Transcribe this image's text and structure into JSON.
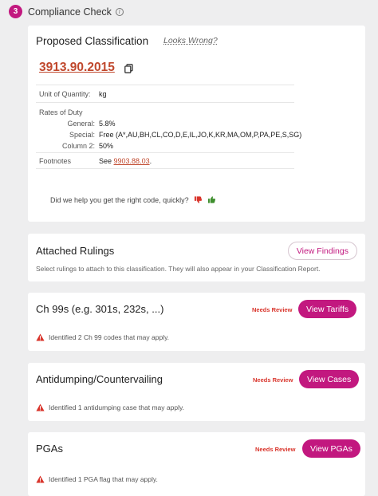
{
  "header": {
    "step_number": "3",
    "title": "Compliance Check",
    "info_icon": "info-icon"
  },
  "classification": {
    "title": "Proposed Classification",
    "looks_wrong_label": "Looks Wrong?",
    "hts_code": "3913.90.2015",
    "copy_icon": "copy-icon",
    "unit_of_quantity_label": "Unit of Quantity:",
    "unit_of_quantity_value": "kg",
    "rates_of_duty_label": "Rates of Duty",
    "general_label": "General:",
    "general_value": "5.8%",
    "special_label": "Special:",
    "special_value": "Free (A*,AU,BH,CL,CO,D,E,IL,JO,K,KR,MA,OM,P,PA,PE,S,SG)",
    "column2_label": "Column 2:",
    "column2_value": "50%",
    "footnotes_label": "Footnotes",
    "footnotes_prefix": "See",
    "footnotes_link": "9903.88.03",
    "footnotes_suffix": ".",
    "feedback_question": "Did we help you get the right code, quickly?",
    "thumbs_down_icon": "thumbs-down-icon",
    "thumbs_up_icon": "thumbs-up-icon"
  },
  "rulings": {
    "title": "Attached Rulings",
    "button_label": "View Findings",
    "description": "Select rulings to attach to this classification. They will also appear in your Classification Report."
  },
  "ch99": {
    "title": "Ch 99s (e.g. 301s, 232s, ...)",
    "status": "Needs Review",
    "button_label": "View Tariffs",
    "warning": "Identified 2 Ch 99 codes that may apply."
  },
  "antidumping": {
    "title": "Antidumping/Countervailing",
    "status": "Needs Review",
    "button_label": "View Cases",
    "warning": "Identified 1 antidumping case that may apply."
  },
  "pgas": {
    "title": "PGAs",
    "status": "Needs Review",
    "button_label": "View PGAs",
    "warning": "Identified 1 PGA flag that may apply."
  },
  "colors": {
    "accent": "#c2187f",
    "link": "#c0482d",
    "warning": "#d9342b",
    "thumbs_down": "#d9342b",
    "thumbs_up": "#3f8f2e"
  }
}
